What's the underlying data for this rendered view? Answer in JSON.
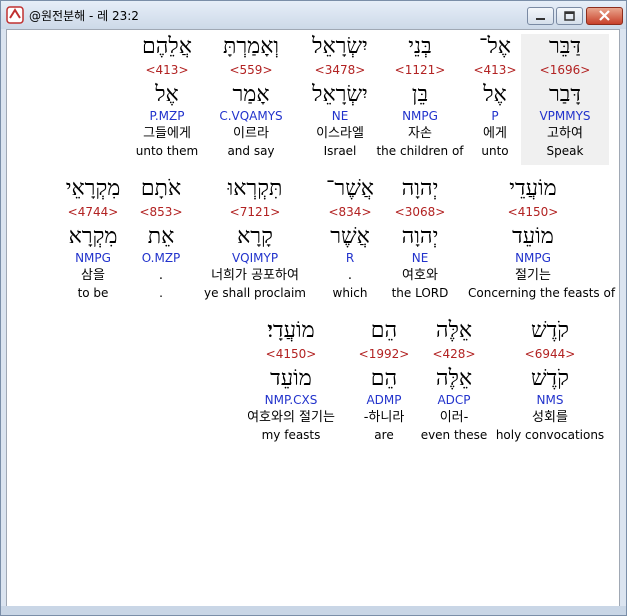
{
  "window": {
    "title": "@원전분해 - 레 23:2"
  },
  "rows": [
    [
      {
        "heb": "דַּבֵּר",
        "num": "<1696>",
        "lemma": "דָּבַר",
        "morph": "VPMMYS",
        "kor": "고하여",
        "eng": "Speak",
        "highlight": true
      },
      {
        "heb": "אֶל־",
        "num": "<413>",
        "lemma": "אֶל",
        "morph": "P",
        "kor": "에게",
        "eng": "unto"
      },
      {
        "heb": "בְּנֵי",
        "num": "<1121>",
        "lemma": "בֵּן",
        "morph": "NMPG",
        "kor": "자손",
        "eng": "the children of"
      },
      {
        "heb": "יִשְׂרָאֵל",
        "num": "<3478>",
        "lemma": "יִשְׂרָאֵל",
        "morph": "NE",
        "kor": "이스라엘",
        "eng": "Israel"
      },
      {
        "heb": "וְאָמַרְתָּ",
        "num": "<559>",
        "lemma": "אָמַר",
        "morph": "C.VQAMYS",
        "kor": "이르라",
        "eng": "and say"
      },
      {
        "heb": "אֲלֵהֶם",
        "num": "<413>",
        "lemma": "אֶל",
        "morph": "P.MZP",
        "kor": "그들에게",
        "eng": "unto them"
      }
    ],
    [
      {
        "heb": "מוֹעֲדֵי",
        "num": "<4150>",
        "lemma": "מוֹעֵד",
        "morph": "NMPG",
        "kor": "절기는",
        "eng": "Concerning the feasts of"
      },
      {
        "heb": "יְהוָה",
        "num": "<3068>",
        "lemma": "יְהוָה",
        "morph": "NE",
        "kor": "여호와",
        "eng": "the LORD"
      },
      {
        "heb": "אֲשֶׁר־",
        "num": "<834>",
        "lemma": "אֲשֶׁר",
        "morph": "R",
        "kor": ".",
        "eng": "which"
      },
      {
        "heb": "תִּקְרְאוּ",
        "num": "<7121>",
        "lemma": "קָרָא",
        "morph": "VQIMYP",
        "kor": "너희가 공포하여",
        "eng": "ye shall proclaim"
      },
      {
        "heb": "אֹתָם",
        "num": "<853>",
        "lemma": "אֵת",
        "morph": "O.MZP",
        "kor": ".",
        "eng": "."
      },
      {
        "heb": "מִקְרָאֵי",
        "num": "<4744>",
        "lemma": "מִקְרָא",
        "morph": "NMPG",
        "kor": "삼을",
        "eng": "to be"
      }
    ],
    [
      {
        "heb": "קֹדֶשׁ",
        "num": "<6944>",
        "lemma": "קֹדֶשׁ",
        "morph": "NMS",
        "kor": "성회를",
        "eng": "holy convocations"
      },
      {
        "heb": "אֵלֶּה",
        "num": "<428>",
        "lemma": "אֵלֶּה",
        "morph": "ADCP",
        "kor": "이러-",
        "eng": "even these"
      },
      {
        "heb": "הֵם",
        "num": "<1992>",
        "lemma": "הֵם",
        "morph": "ADMP",
        "kor": "-하니라",
        "eng": "are"
      },
      {
        "heb": "מוֹעֲדָי׃",
        "num": "<4150>",
        "lemma": "מוֹעֵד",
        "morph": "NMP.CXS",
        "kor": "여호와의 절기는",
        "eng": "my feasts"
      }
    ]
  ]
}
